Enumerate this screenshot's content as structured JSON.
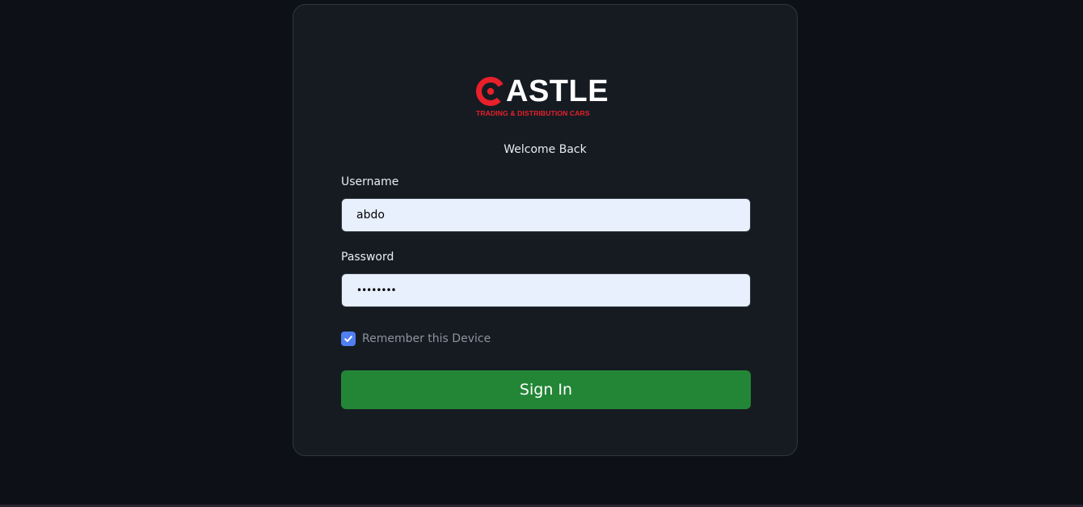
{
  "brand": {
    "logo_word": "ASTLE",
    "logo_tagline": "TRADING & DISTRIBUTION CARS",
    "logo_accent_color": "#e8202a"
  },
  "login": {
    "welcome_text": "Welcome Back",
    "username_label": "Username",
    "username_value": "abdo",
    "password_label": "Password",
    "password_value": "••••••••",
    "remember_label": "Remember this Device",
    "remember_checked": true,
    "signin_label": "Sign In"
  },
  "colors": {
    "background": "#0d1117",
    "card": "#161b22",
    "input_background": "#e8f0fe",
    "checkbox": "#4f7ff0",
    "signin_button": "#238636"
  },
  "icons": {
    "logo_mark": "castle-c-logo-icon",
    "checkbox_mark": "check-icon"
  }
}
